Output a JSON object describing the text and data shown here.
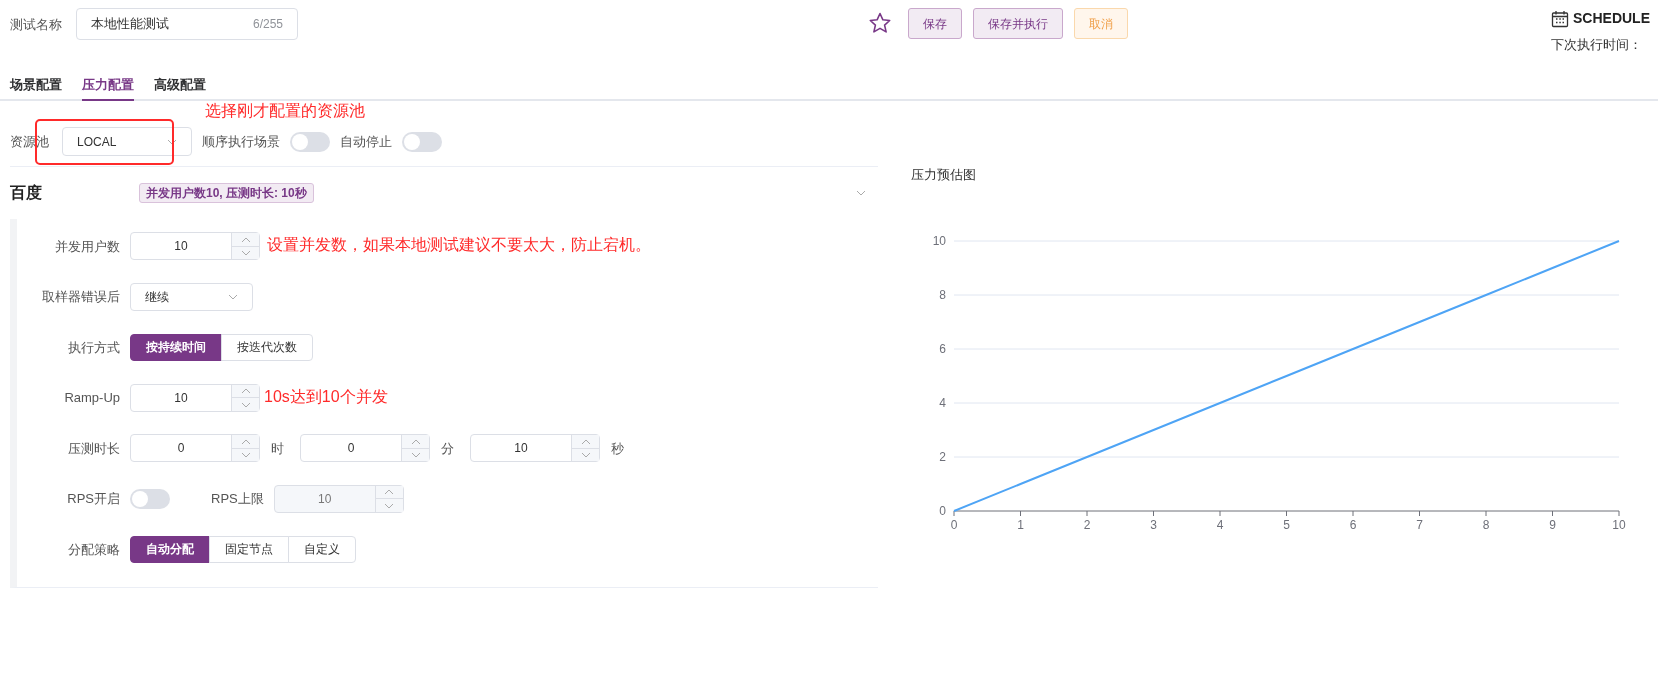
{
  "header": {
    "name_label": "测试名称",
    "name_value": "本地性能测试",
    "name_count": "6/255",
    "buttons": [
      {
        "label": "保存",
        "kind": "primary"
      },
      {
        "label": "保存并执行",
        "kind": "primary"
      },
      {
        "label": "取消",
        "kind": "warning"
      }
    ]
  },
  "schedule": {
    "title": "SCHEDULE",
    "next_label": "下次执行时间："
  },
  "tabs": [
    {
      "label": "场景配置",
      "selected": false
    },
    {
      "label": "压力配置",
      "selected": true
    },
    {
      "label": "高级配置",
      "selected": false
    }
  ],
  "pool": {
    "label": "资源池",
    "value": "LOCAL",
    "note": "选择刚才配置的资源池"
  },
  "toggles": [
    {
      "label": "顺序执行场景",
      "on": false
    },
    {
      "label": "自动停止",
      "on": false
    }
  ],
  "scenario": {
    "name": "百度",
    "summary": "并发用户数10, 压测时长: 10秒",
    "expanded": true
  },
  "fields": [
    {
      "kind": "number",
      "label": "并发用户数",
      "value": "10",
      "note": "设置并发数，如果本地测试建议不要太大，防止宕机。"
    },
    {
      "kind": "select",
      "label": "取样器错误后",
      "value": "继续"
    },
    {
      "kind": "segmented",
      "label": "执行方式",
      "options": [
        {
          "label": "按持续时间",
          "selected": true
        },
        {
          "label": "按迭代次数",
          "selected": false
        }
      ]
    },
    {
      "kind": "number",
      "label": "Ramp-Up",
      "value": "10",
      "note": "10s达到10个并发"
    },
    {
      "kind": "duration",
      "label": "压测时长",
      "parts": [
        {
          "value": "0",
          "unit": "时"
        },
        {
          "value": "0",
          "unit": "分"
        },
        {
          "value": "10",
          "unit": "秒"
        }
      ]
    },
    {
      "kind": "rps",
      "label": "RPS开启",
      "on": false,
      "limit_label": "RPS上限",
      "limit_value": "10",
      "limit_disabled": true
    },
    {
      "kind": "segmented",
      "label": "分配策略",
      "options": [
        {
          "label": "自动分配",
          "selected": true
        },
        {
          "label": "固定节点",
          "selected": false
        },
        {
          "label": "自定义",
          "selected": false
        }
      ]
    }
  ],
  "chart": {
    "chart_data": {
      "type": "line",
      "title": "压力预估图",
      "x": [
        0,
        1,
        2,
        3,
        4,
        5,
        6,
        7,
        8,
        9,
        10
      ],
      "grid": true,
      "series": [
        {
          "color": "#4ea4f5",
          "values": [
            0,
            1,
            2,
            3,
            4,
            5,
            6,
            7,
            8,
            9,
            10
          ]
        }
      ],
      "xlim": [
        0,
        10
      ],
      "ylim": [
        0,
        10
      ],
      "xticks": [
        0,
        1,
        2,
        3,
        4,
        5,
        6,
        7,
        8,
        9,
        10
      ],
      "yticks": [
        0,
        2,
        4,
        6,
        8,
        10
      ]
    }
  }
}
